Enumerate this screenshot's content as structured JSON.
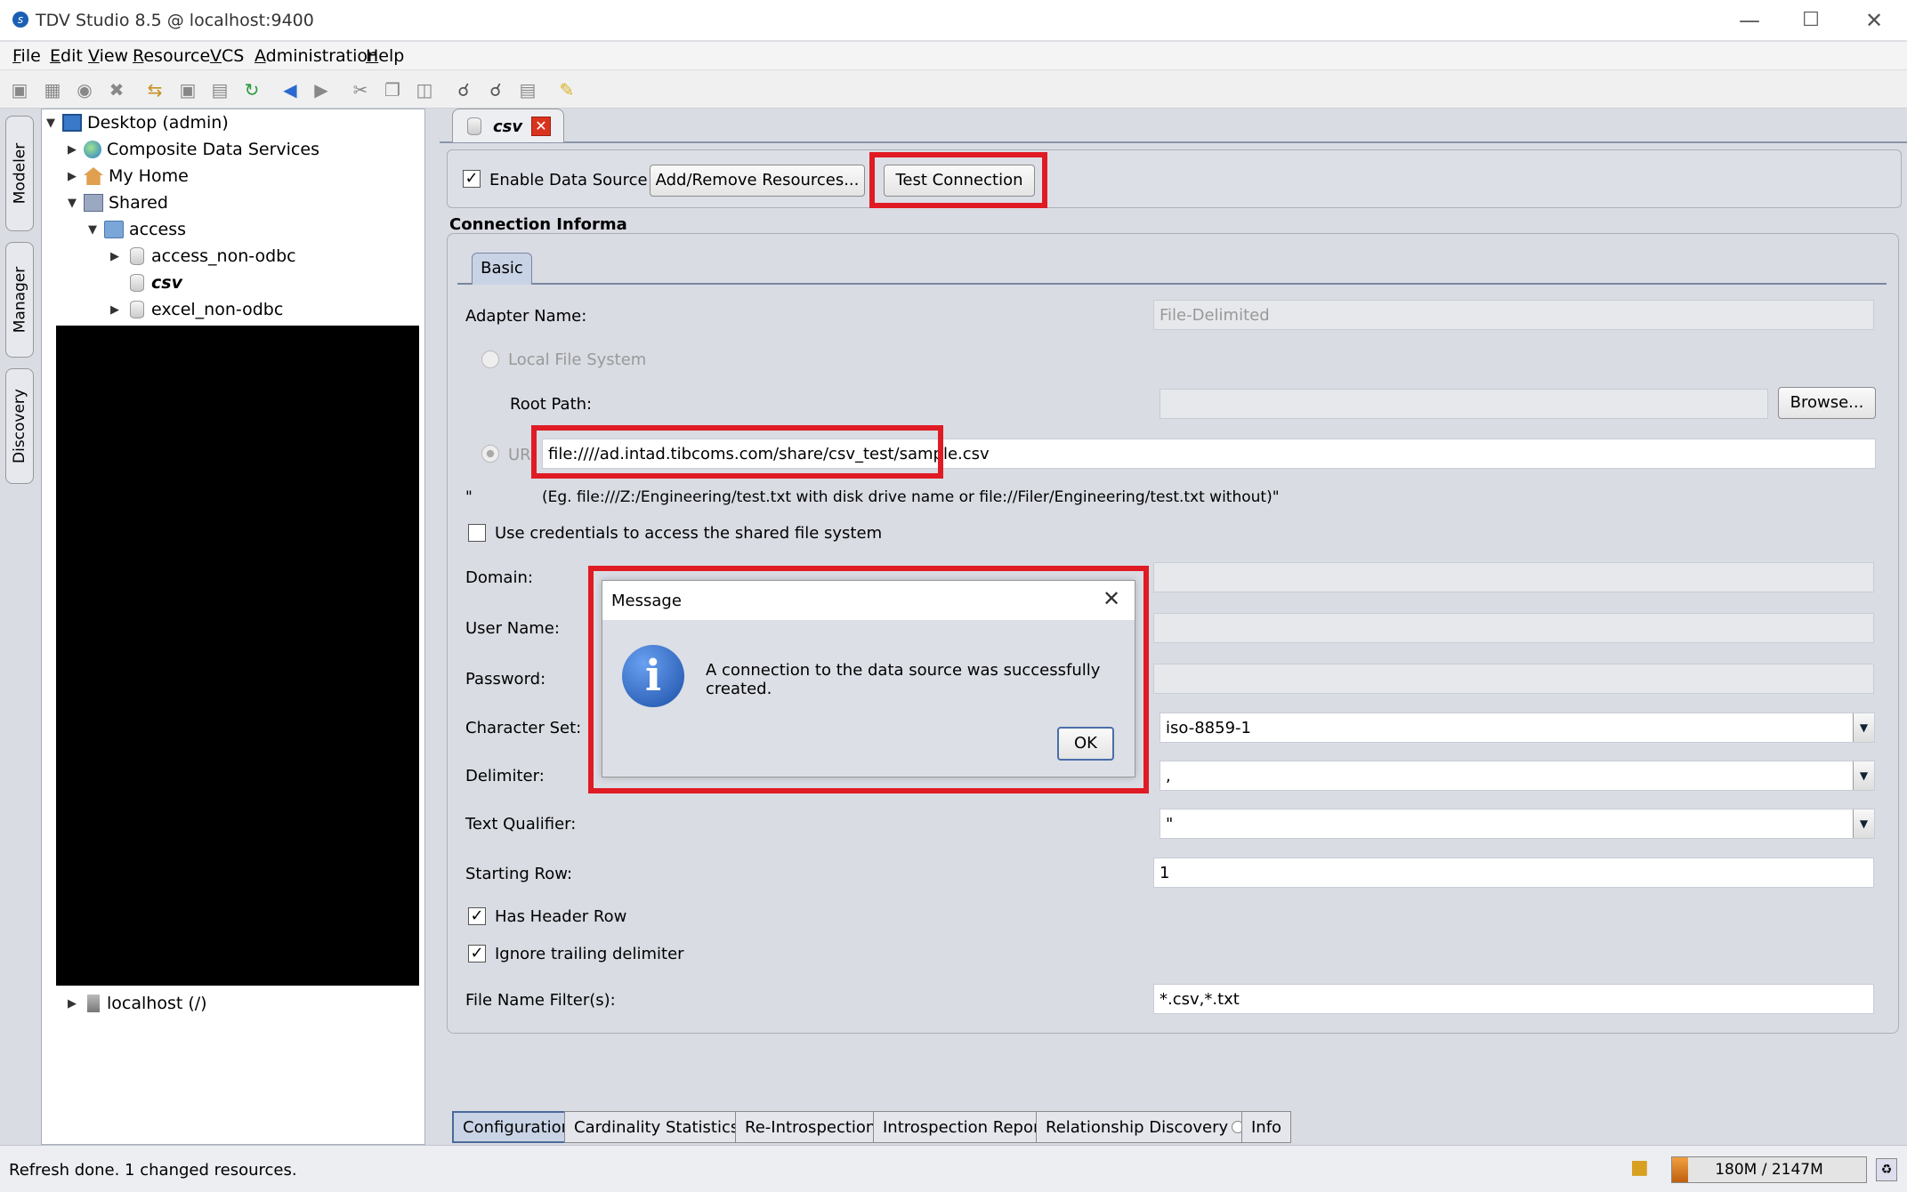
{
  "window": {
    "title": "TDV Studio 8.5 @ localhost:9400",
    "controls": [
      "minimize",
      "maximize",
      "close"
    ]
  },
  "menu": [
    "File",
    "Edit",
    "View",
    "Resource",
    "VCS",
    "Administration",
    "Help"
  ],
  "side_tabs": [
    "Modeler",
    "Manager",
    "Discovery"
  ],
  "tree": {
    "root": "Desktop (admin)",
    "composite": "Composite Data Services",
    "home": "My Home",
    "shared": "Shared",
    "access": "access",
    "access_non_odbc": "access_non-odbc",
    "csv": "csv",
    "excel": "excel_non-odbc",
    "localhost": "localhost (/)"
  },
  "editor": {
    "tab_label": "csv",
    "enable_label": "Enable Data Source",
    "add_remove_label": "Add/Remove Resources...",
    "test_connection_label": "Test Connection",
    "connection_info": "Connection Informatio",
    "basic_tab": "Basic",
    "adapter_label": "Adapter Name:",
    "adapter_value": "File-Delimited",
    "local_fs_label": "Local File System",
    "root_path_label": "Root Path:",
    "browse_label": "Browse...",
    "url_label": "UR",
    "url_value": "file:////ad.intad.tibcoms.com/share/csv_test/sample.csv",
    "hint_quote": "\"",
    "hint": "(Eg. file:///Z:/Engineering/test.txt with disk drive name or file://Filer/Engineering/test.txt without)\"",
    "use_creds_label": "Use credentials to access the shared file system",
    "domain_label": "Domain:",
    "username_label": "User Name:",
    "password_label": "Password:",
    "charset_label": "Character Set:",
    "charset_value": "iso-8859-1",
    "delimiter_label": "Delimiter:",
    "delimiter_value": ",",
    "qualifier_label": "Text Qualifier:",
    "qualifier_value": "\"",
    "starting_row_label": "Starting Row:",
    "starting_row_value": "1",
    "header_row_label": "Has Header Row",
    "ignore_trailing_label": "Ignore trailing delimiter",
    "filter_label": "File Name Filter(s):",
    "filter_value": "*.csv,*.txt"
  },
  "dialog": {
    "title": "Message",
    "message": "A connection to the data source was successfully created.",
    "ok": "OK"
  },
  "bottom_tabs": [
    "Configuration",
    "Cardinality Statistics",
    "Re-Introspection",
    "Introspection Report",
    "Relationship Discovery",
    "Info"
  ],
  "status": {
    "text": "Refresh done. 1 changed resources.",
    "memory": "180M / 2147M",
    "memory_fraction": 0.084
  }
}
